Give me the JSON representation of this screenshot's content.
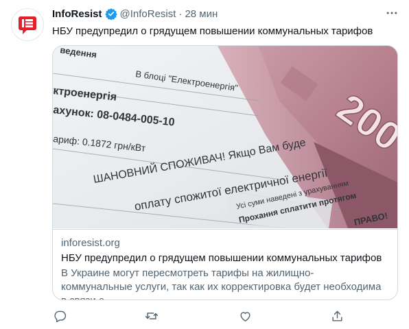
{
  "tweet": {
    "author_name": "InfoResist",
    "author_handle": "@InfoResist",
    "separator": "·",
    "time": "28 мин",
    "text": "НБУ предупредил о грядущем повышении коммунальных тарифов",
    "verified_icon": "verified-badge-icon",
    "more_icon": "more-options-icon",
    "accent_color": "#1d9bf0",
    "avatar_color": "#e5202b"
  },
  "card": {
    "domain": "inforesist.org",
    "title": "НБУ предупредил о грядущем повышении коммунальных тарифов",
    "description": "В Украине могут пересмотреть тарифы на жилищно-коммунальные услуги, так как их корректировка будет необходима в связи с …",
    "image": {
      "bill_lines": [
        "ведення",
        "В блоці \"Електроенергія\"",
        "ктроенергія",
        "ахунок: 08-0484-005-10",
        "ариф: 0.1872 грн/кВт",
        "ШАНОВНИЙ СПОЖИВАЧ! Якщо Вам буде",
        "оплату спожитої електричної енергії",
        "Усі суми наведені з урахуванням",
        "Прохання сплатити протягом",
        "ПРАВО!"
      ],
      "banknote_value": "200"
    }
  },
  "actions": {
    "reply_icon": "reply-icon",
    "retweet_icon": "retweet-icon",
    "like_icon": "like-icon",
    "share_icon": "share-icon"
  }
}
